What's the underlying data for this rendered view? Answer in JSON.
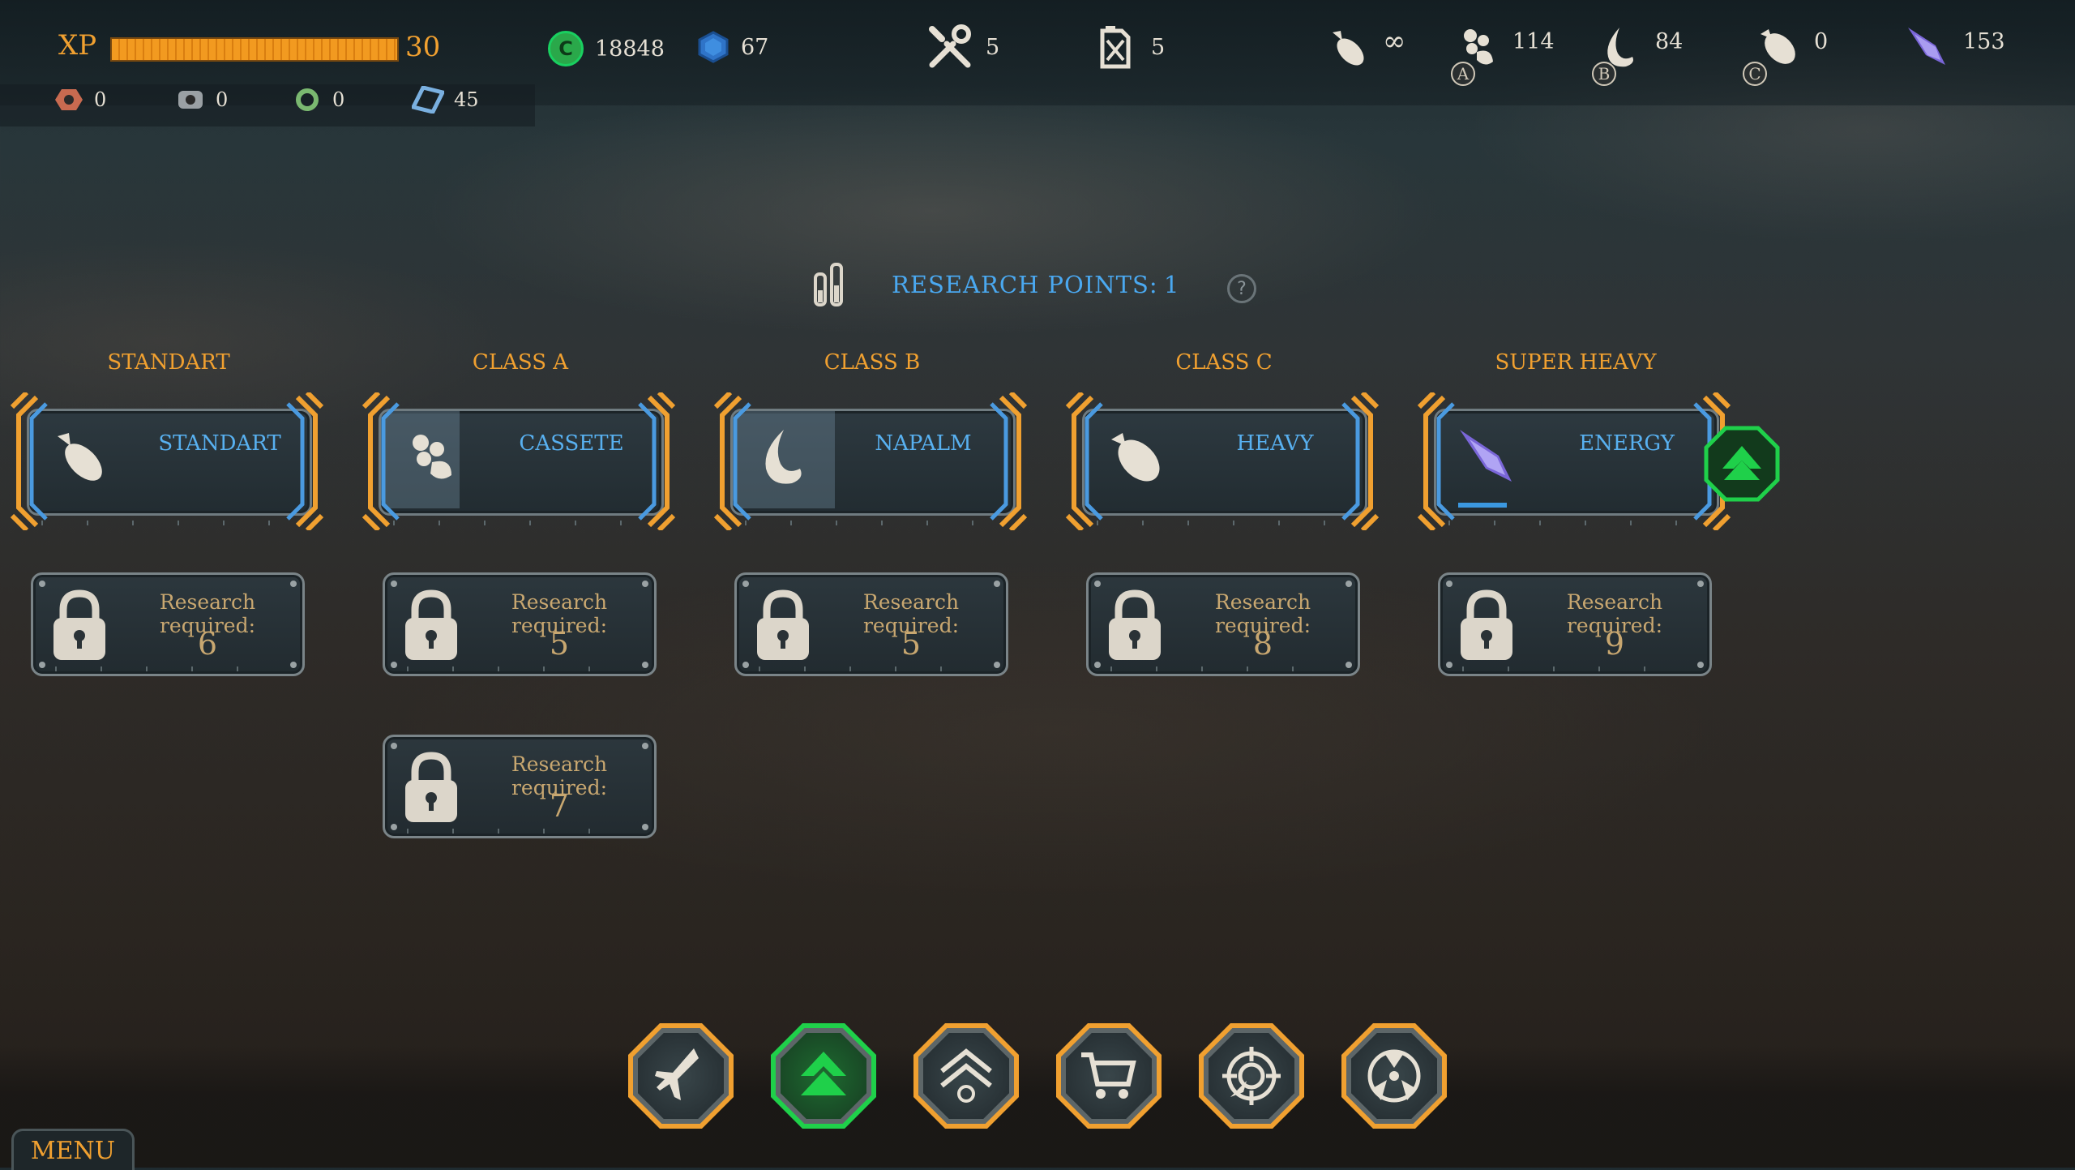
{
  "top_bar": {
    "xp_label": "XP",
    "xp_progress": 1.0,
    "xp_value": "30",
    "credits": "18848",
    "crystals": "67",
    "tools": "5",
    "fuel": "5",
    "ammo_standart": "∞",
    "ammo_a": "114",
    "ammo_b": "84",
    "ammo_c": "0",
    "ammo_super": "153",
    "badge_a": "A",
    "badge_b": "B",
    "badge_c": "C",
    "res_copper": "0",
    "res_steel": "0",
    "res_green": "0",
    "res_blue": "45",
    "credit_symbol": "C"
  },
  "research": {
    "label": "RESEARCH POINTS:",
    "points": "1",
    "help": "?"
  },
  "columns": [
    {
      "title": "STANDART",
      "weapon": "STANDART",
      "icon": "bomb-icon",
      "fill": 0.0,
      "locks": [
        {
          "text": "Research required:",
          "num": "6"
        }
      ]
    },
    {
      "title": "CLASS A",
      "weapon": "CASSETE",
      "icon": "cluster-icon",
      "fill": 0.5,
      "locks": [
        {
          "text": "Research required:",
          "num": "5"
        },
        {
          "text": "Research required:",
          "num": "7"
        }
      ]
    },
    {
      "title": "CLASS B",
      "weapon": "NAPALM",
      "icon": "flame-icon",
      "fill": 0.65,
      "locks": [
        {
          "text": "Research required:",
          "num": "5"
        }
      ]
    },
    {
      "title": "CLASS C",
      "weapon": "HEAVY",
      "icon": "heavy-bomb-icon",
      "fill": 0.0,
      "locks": [
        {
          "text": "Research required:",
          "num": "8"
        }
      ]
    },
    {
      "title": "SUPER HEAVY",
      "weapon": "ENERGY",
      "icon": "energy-missile-icon",
      "fill": 0.0,
      "progress": 0.2,
      "locks": [
        {
          "text": "Research required:",
          "num": "9"
        }
      ]
    }
  ],
  "nav": [
    {
      "name": "hangar",
      "icon": "jet-icon",
      "active": false
    },
    {
      "name": "upgrades",
      "icon": "upgrade-arrow-icon",
      "active": true
    },
    {
      "name": "ranks",
      "icon": "rank-chevron-icon",
      "active": false
    },
    {
      "name": "shop",
      "icon": "cart-icon",
      "active": false
    },
    {
      "name": "missions",
      "icon": "target-icon",
      "active": false
    },
    {
      "name": "base",
      "icon": "radiation-icon",
      "active": false
    }
  ],
  "menu_label": "MENU",
  "colors": {
    "accent_orange": "#f0a030",
    "accent_blue": "#4aa8f0",
    "accent_green": "#1fd04a",
    "lock_text": "#c8a770"
  }
}
